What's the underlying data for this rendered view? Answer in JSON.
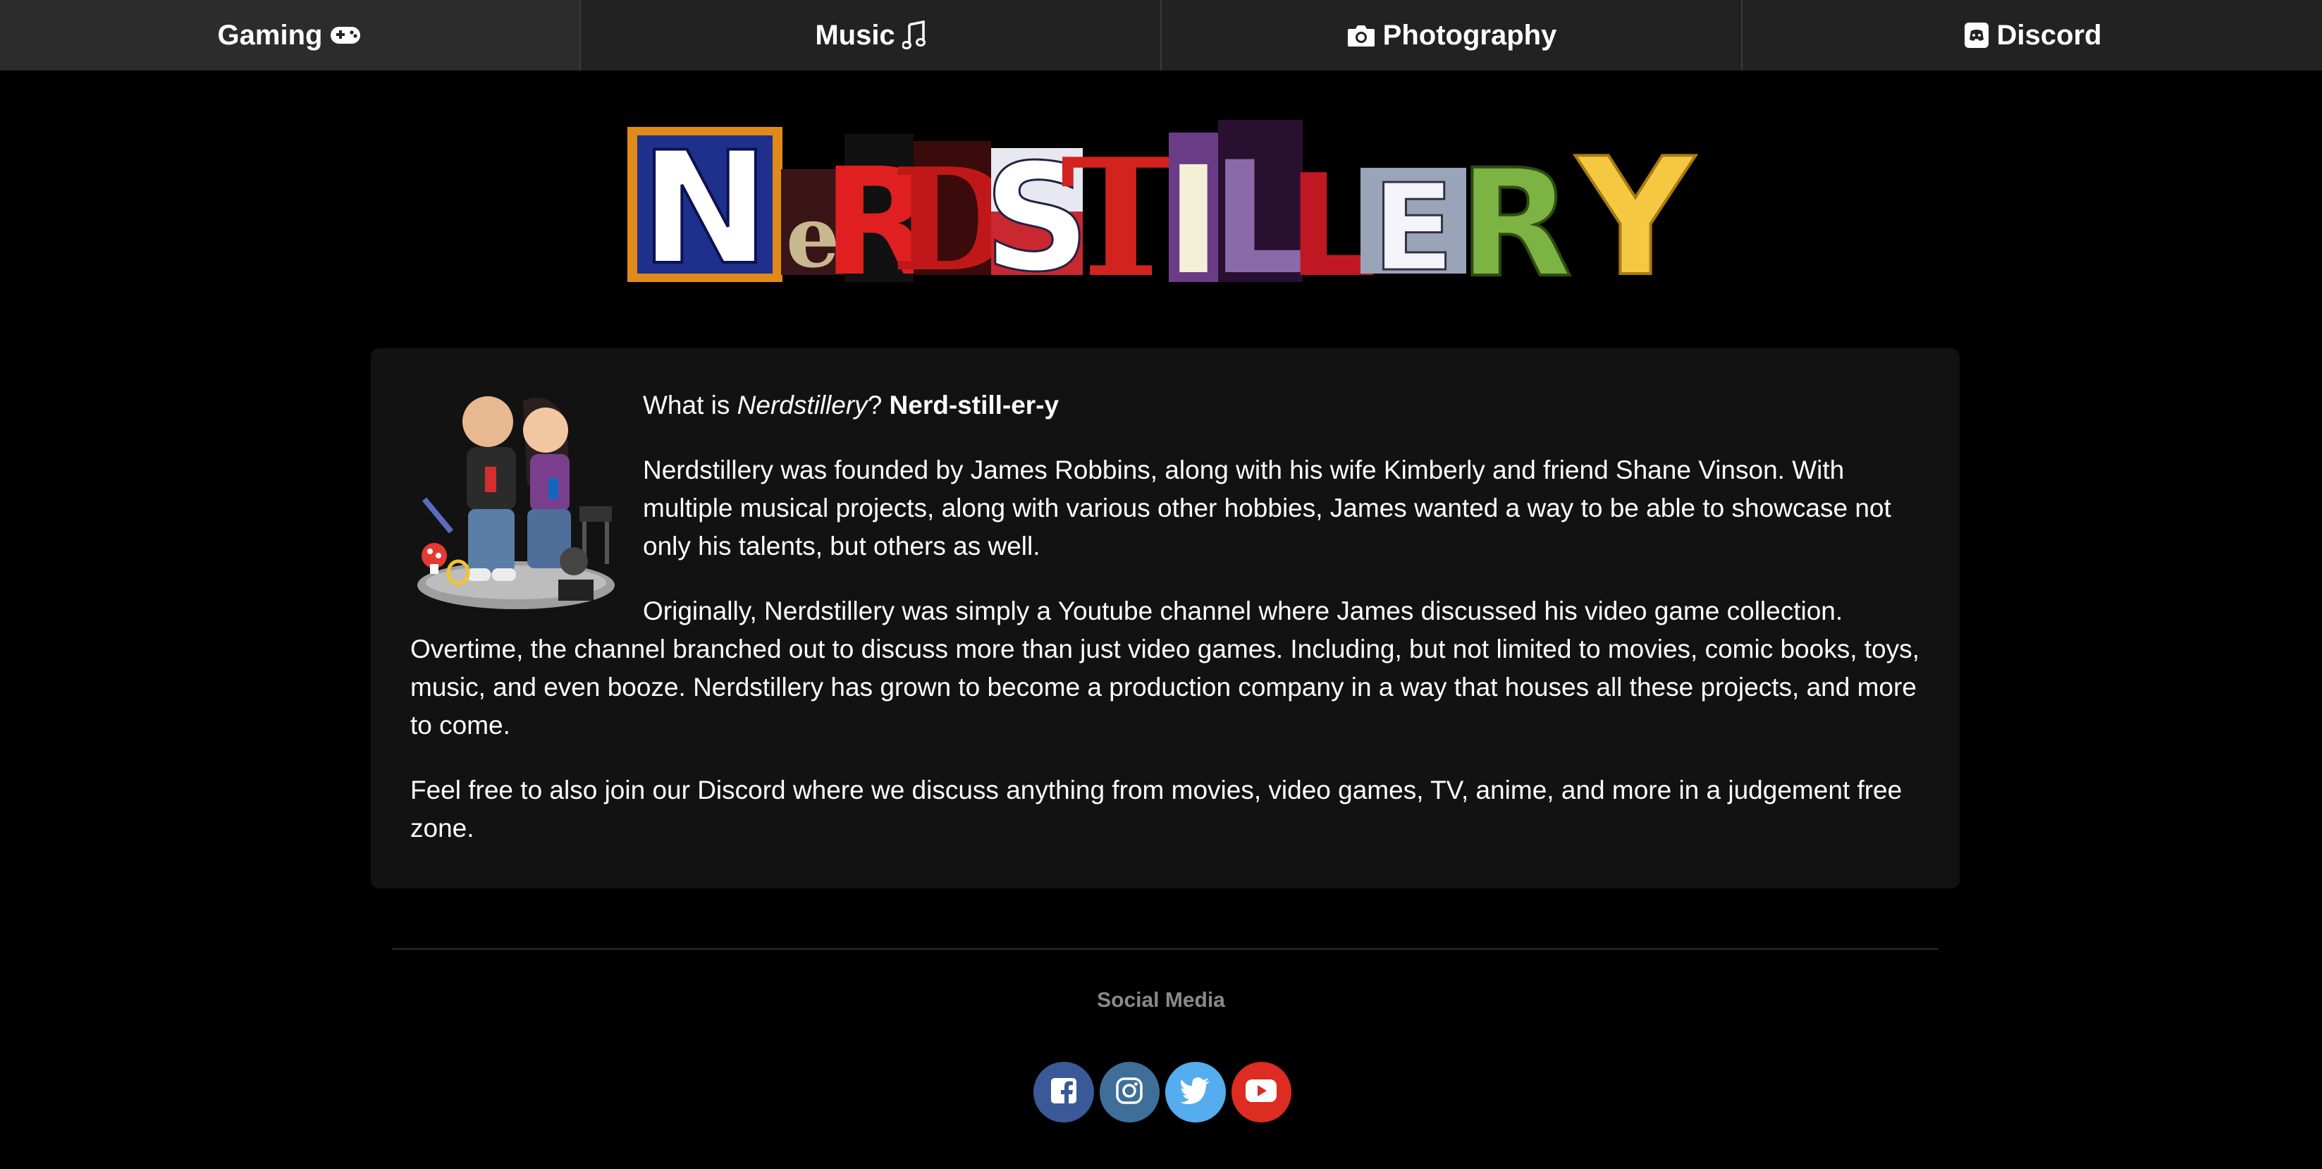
{
  "nav": {
    "items": [
      {
        "label": "Gaming",
        "icon": "gamepad-icon",
        "position": "after"
      },
      {
        "label": "Music",
        "icon": "music-note-icon",
        "position": "after"
      },
      {
        "label": "Photography",
        "icon": "camera-icon",
        "position": "before"
      },
      {
        "label": "Discord",
        "icon": "discord-icon",
        "position": "before"
      }
    ]
  },
  "logo": {
    "text": "NERDSTILLERY",
    "alt": "Nerdstillery"
  },
  "about": {
    "intro_prefix": "What is ",
    "intro_name": "Nerdstillery",
    "intro_suffix": "? ",
    "pronunciation": "Nerd-still-er-y",
    "paragraph_1": "Nerdstillery was founded by James Robbins, along with his wife Kimberly and friend Shane Vinson. With multiple musical projects, along with various other hobbies, James wanted a way to be able to showcase not only his talents, but others as well.",
    "paragraph_2": "Originally, Nerdstillery was simply a Youtube channel where James discussed his video game collection. Overtime, the channel branched out to discuss more than just video games. Including, but not limited to movies, comic books, toys, music, and even booze. Nerdstillery has grown to become a production company in a way that houses all these projects, and more to come.",
    "paragraph_3": "Feel free to also join our Discord where we discuss anything from movies, video games, TV, anime, and more in a judgement free zone."
  },
  "footer": {
    "social_heading": "Social Media",
    "social": [
      {
        "name": "facebook",
        "icon": "facebook-icon",
        "color": "#3b5998"
      },
      {
        "name": "instagram",
        "icon": "instagram-icon",
        "color": "#3f6f99"
      },
      {
        "name": "twitter",
        "icon": "twitter-icon",
        "color": "#55acee"
      },
      {
        "name": "youtube",
        "icon": "youtube-icon",
        "color": "#dd2c22"
      }
    ]
  },
  "colors": {
    "background": "#000000",
    "nav_background": "#222222",
    "card_background": "#121212",
    "muted_text": "#8a8a8a"
  }
}
